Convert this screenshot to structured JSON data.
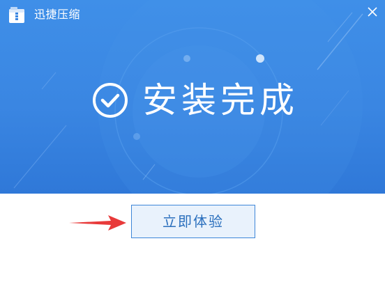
{
  "window": {
    "title": "迅捷压缩",
    "close_glyph": "✕"
  },
  "hero": {
    "status_text": "安装完成",
    "icon": "check-circle-icon"
  },
  "actions": {
    "start_label": "立即体验"
  },
  "colors": {
    "banner_top": "#3f8fe8",
    "banner_bottom": "#2f78d8",
    "button_border": "#3d86d8",
    "button_bg": "#e9f2fc",
    "button_text": "#2a6fbd",
    "arrow": "#e83a3a"
  }
}
